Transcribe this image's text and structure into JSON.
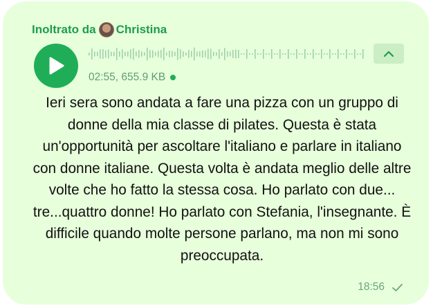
{
  "message": {
    "forwarded_label": "Inoltrato da",
    "forwarded_from": "Christina",
    "audio": {
      "duration_size": "02:55, 655.9 KB"
    },
    "text": "Ieri sera sono andata a fare una pizza con un gruppo di donne della mia classe di pilates. Questa è stata un'opportunità per ascoltare l'italiano e parlare in italiano con donne italiane. Questa volta è andata meglio delle altre volte che ho fatto la stessa cosa. Ho parlato con due... tre...quattro donne! Ho parlato con Stefania, l'insegnante. È difficile quando molte persone parlano, ma non mi sono preoccupata.",
    "time": "18:56",
    "status_icon": "check-icon"
  },
  "colors": {
    "bubble": "#e7ffdb",
    "accent": "#1fae57",
    "forwarded": "#1d9d4e",
    "meta": "#5f9d73"
  }
}
